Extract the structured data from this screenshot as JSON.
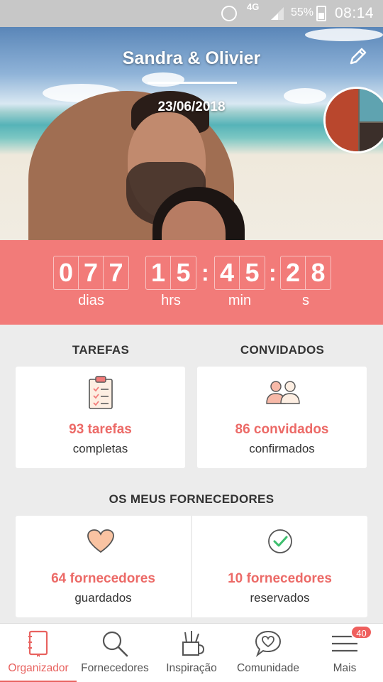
{
  "status_bar": {
    "network": "4G",
    "battery": "55%",
    "time": "08:14",
    "icons": [
      "alarm-icon",
      "signal-icon",
      "battery-icon"
    ]
  },
  "header": {
    "couple_name": "Sandra & Olivier",
    "wedding_date": "23/06/2018",
    "icons": [
      "edit-icon",
      "avatar-stack"
    ]
  },
  "countdown": {
    "days": [
      "0",
      "7",
      "7"
    ],
    "hours": [
      "1",
      "5"
    ],
    "minutes": [
      "4",
      "5"
    ],
    "seconds": [
      "2",
      "8"
    ],
    "labels": {
      "days": "dias",
      "hours": "hrs",
      "minutes": "min",
      "seconds": "s"
    }
  },
  "tasks": {
    "title": "TAREFAS",
    "value": "93 tarefas",
    "sub": "completas",
    "icon": "clipboard-icon"
  },
  "guests": {
    "title": "CONVIDADOS",
    "value": "86 convidados",
    "sub": "confirmados",
    "icon": "guests-icon"
  },
  "vendors": {
    "title": "OS MEUS FORNECEDORES",
    "saved": {
      "value": "64 fornecedores",
      "sub": "guardados",
      "icon": "heart-icon"
    },
    "booked": {
      "value": "10 fornecedores",
      "sub": "reservados",
      "icon": "check-circle-icon"
    }
  },
  "nav": {
    "items": [
      {
        "label": "Organizador",
        "icon": "notebook-icon",
        "active": true
      },
      {
        "label": "Fornecedores",
        "icon": "search-icon"
      },
      {
        "label": "Inspiração",
        "icon": "pencil-cup-icon"
      },
      {
        "label": "Comunidade",
        "icon": "chat-heart-icon"
      },
      {
        "label": "Mais",
        "icon": "menu-icon"
      }
    ],
    "badge": "40"
  },
  "colors": {
    "accent": "#f27b79",
    "accent_text": "#ec6a67",
    "background": "#ececec"
  }
}
